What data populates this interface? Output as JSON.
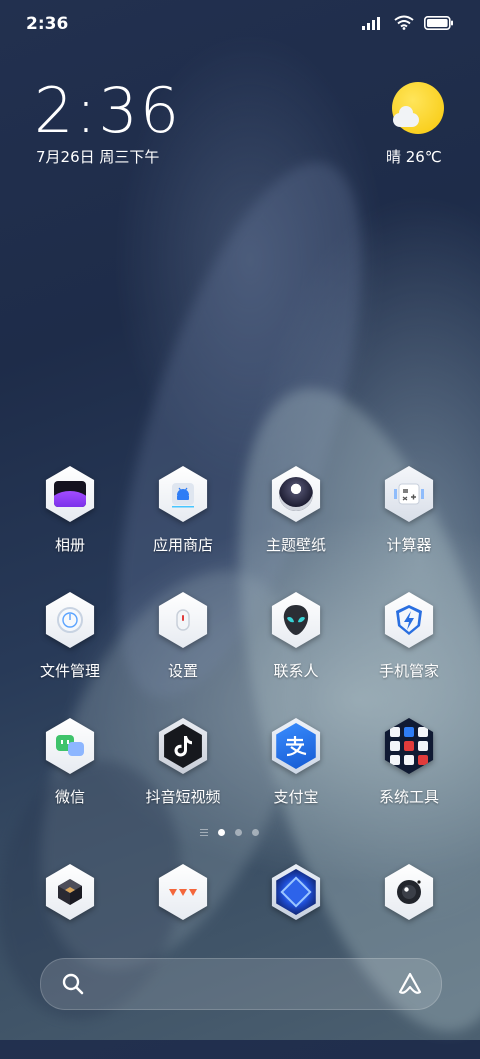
{
  "status_bar": {
    "time": "2:36",
    "battery_level": 1.0
  },
  "clock_widget": {
    "time": "2:36",
    "date": "7月26日 周三下午"
  },
  "weather_widget": {
    "condition_icon": "sun-with-cloud-icon",
    "text": "晴 26℃"
  },
  "apps": [
    {
      "label": "相册",
      "icon": "gallery-icon"
    },
    {
      "label": "应用商店",
      "icon": "app-store-icon"
    },
    {
      "label": "主题壁纸",
      "icon": "themes-icon"
    },
    {
      "label": "计算器",
      "icon": "calculator-icon"
    },
    {
      "label": "文件管理",
      "icon": "file-manager-icon"
    },
    {
      "label": "设置",
      "icon": "settings-icon"
    },
    {
      "label": "联系人",
      "icon": "contacts-icon"
    },
    {
      "label": "手机管家",
      "icon": "security-icon"
    },
    {
      "label": "微信",
      "icon": "wechat-icon"
    },
    {
      "label": "抖音短视频",
      "icon": "douyin-icon"
    },
    {
      "label": "支付宝",
      "icon": "alipay-icon"
    },
    {
      "label": "系统工具",
      "icon": "system-tools-folder-icon"
    }
  ],
  "page_indicator": {
    "pages": 3,
    "current": 1
  },
  "dock": [
    {
      "icon": "dock-cube-icon"
    },
    {
      "icon": "dock-messages-icon"
    },
    {
      "icon": "dock-browser-icon"
    },
    {
      "icon": "dock-camera-icon"
    }
  ],
  "search_bar": {
    "left_icon": "search-icon",
    "right_icon": "assistant-icon"
  },
  "colors": {
    "weather_sun": "#f7c80a",
    "security_blue": "#2a6fe0",
    "alipay_blue": "#1b6fe0"
  }
}
